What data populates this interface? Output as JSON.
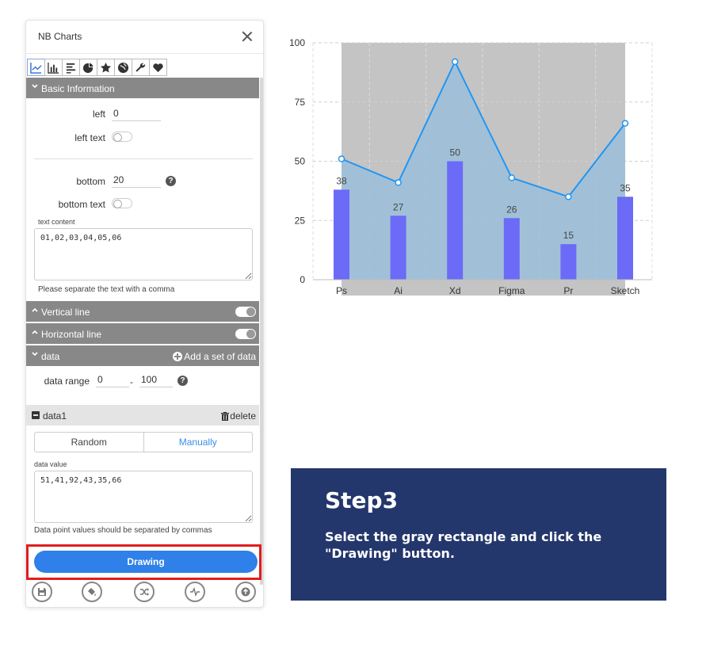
{
  "panel": {
    "title": "NB Charts",
    "toolbar_icons": [
      "line-chart-icon",
      "bar-chart-icon",
      "list-icon",
      "pie-chart-icon",
      "star-icon",
      "globe-icon",
      "wrench-icon",
      "heart-icon"
    ],
    "sections": {
      "basic_information": "Basic Information",
      "vertical_line": "Vertical line",
      "horizontal_line": "Horizontal line",
      "data": "data",
      "add_data": "Add a set of data"
    },
    "fields": {
      "left_label": "left",
      "left_value": "0",
      "left_text_label": "left text",
      "bottom_label": "bottom",
      "bottom_value": "20",
      "bottom_text_label": "bottom text",
      "text_content_label": "text content",
      "text_content_value": "01,02,03,04,05,06",
      "text_hint": "Please separate the text with a comma",
      "data_range_label": "data range",
      "range_min": "0",
      "range_sep": "-",
      "range_max": "100"
    },
    "data1": {
      "title": "data1",
      "delete_label": "delete",
      "mode_random": "Random",
      "mode_manual": "Manually",
      "selected_mode": "Manually",
      "value_label": "data value",
      "value": "51,41,92,43,35,66",
      "hint": "Data point values should be separated by commas"
    },
    "drawing_label": "Drawing",
    "bottom_icons": [
      "save-icon",
      "paint-bucket-icon",
      "shuffle-icon",
      "pulse-icon",
      "upload-icon"
    ]
  },
  "chart_data": {
    "type": "bar",
    "categories": [
      "Ps",
      "Ai",
      "Xd",
      "Figma",
      "Pr",
      "Sketch"
    ],
    "series": [
      {
        "type": "bar",
        "values": [
          38,
          27,
          50,
          26,
          15,
          35
        ]
      },
      {
        "type": "line",
        "values": [
          51,
          41,
          92,
          43,
          35,
          66
        ]
      }
    ],
    "ylim": [
      0,
      100
    ],
    "yticks": [
      0,
      25,
      50,
      75,
      100
    ],
    "grid": true,
    "colors": {
      "bar": "#6b6bf7",
      "line": "#2196f3",
      "selection": "#c4c4c4",
      "area": "#9bbfdb"
    }
  },
  "step": {
    "title": "Step3",
    "description": "Select the gray rectangle and click the\n \"Drawing\" button."
  }
}
